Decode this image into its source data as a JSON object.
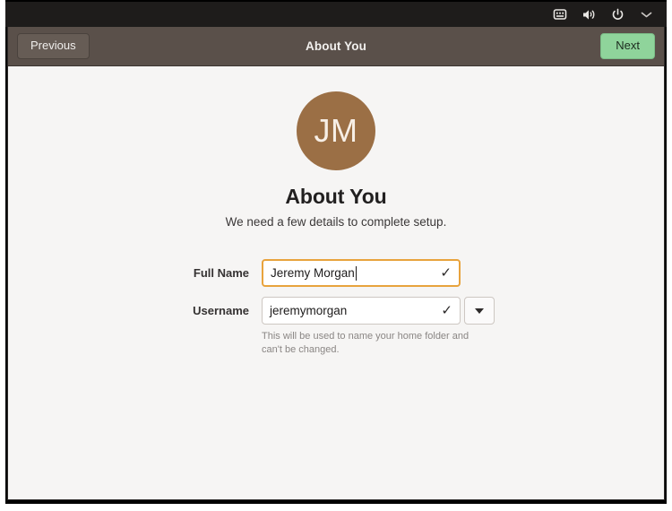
{
  "topbar": {
    "icons": [
      {
        "name": "keyboard-icon",
        "label": "keyboard"
      },
      {
        "name": "volume-icon",
        "label": "volume"
      },
      {
        "name": "power-icon",
        "label": "power"
      },
      {
        "name": "chevron-down-icon",
        "label": "system menu"
      }
    ]
  },
  "header": {
    "previous_label": "Previous",
    "title": "About You",
    "next_label": "Next",
    "bar_color": "#5a504a",
    "next_color": "#8fd49b"
  },
  "main": {
    "avatar_initials": "JM",
    "avatar_color": "#9b6f45",
    "title": "About You",
    "subtitle": "We need a few details to complete setup.",
    "fields": {
      "full_name": {
        "label": "Full Name",
        "value": "Jeremy Morgan",
        "placeholder": "Full Name",
        "valid_icon": "✓",
        "focus_color": "#e8a33d"
      },
      "username": {
        "label": "Username",
        "value": "jeremymorgan",
        "placeholder": "Username",
        "valid_icon": "✓",
        "helper_text": "This will be used to name your home folder and can't be changed."
      }
    }
  }
}
